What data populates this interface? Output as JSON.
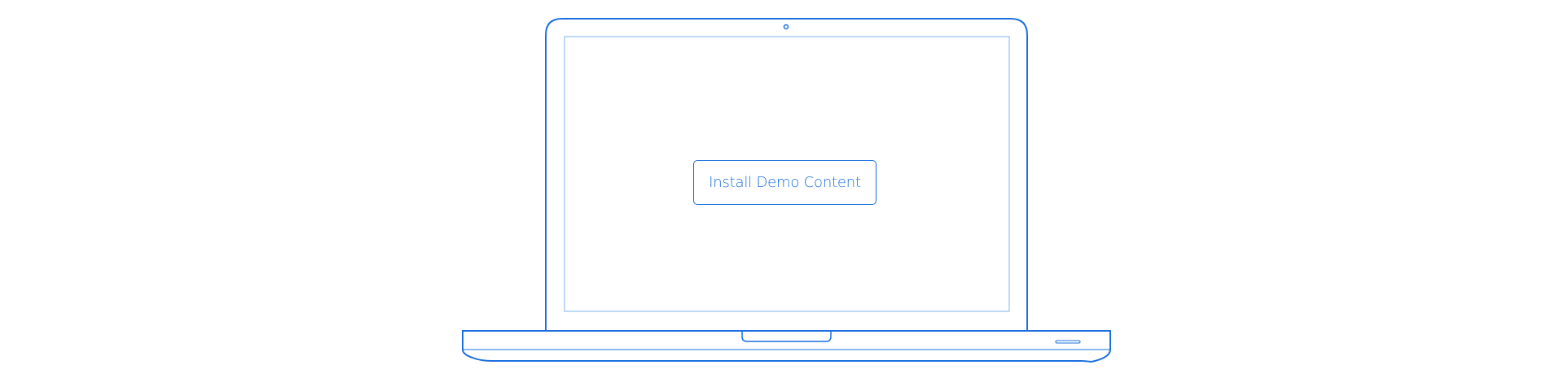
{
  "device": {
    "type": "laptop",
    "outline_color": "#1a6fe0",
    "screen_border_color": "#7fb2ee"
  },
  "screen": {
    "install_button_label": "Install Demo Content"
  }
}
